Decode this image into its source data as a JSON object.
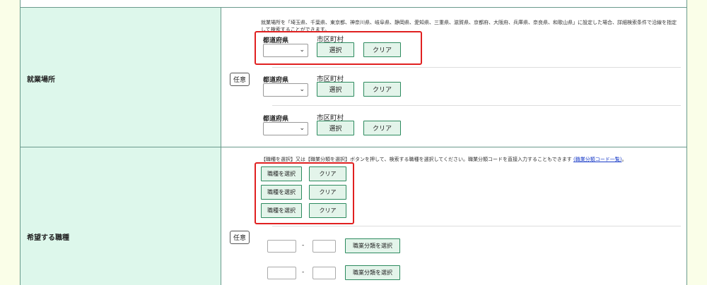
{
  "work_location": {
    "label": "就業場所",
    "optional_badge": "任意",
    "note": "就業場所を「埼玉県、千葉県、東京都、神奈川県、岐阜県、静岡県、愛知県、三重県、滋賀県、京都府、大阪府、兵庫県、奈良県、和歌山県」に設定した場合、詳細検索条件で沿線を指定して検索することができます。",
    "rows": [
      {
        "pref_label": "都道府県",
        "city_label": "市区町村",
        "select_button": "選択",
        "clear_button": "クリア"
      },
      {
        "pref_label": "都道府県",
        "city_label": "市区町村",
        "select_button": "選択",
        "clear_button": "クリア"
      },
      {
        "pref_label": "都道府県",
        "city_label": "市区町村",
        "select_button": "選択",
        "clear_button": "クリア"
      }
    ]
  },
  "desired_job": {
    "label": "希望する職種",
    "optional_badge": "任意",
    "note_text": "【職種を選択】又は【職業分類を選択】ボタンを押して、検索する職種を選択してください。職業分類コードを直接入力することもできます",
    "note_link": "(職業分類コード一覧)",
    "note_end": "。",
    "job_rows": [
      {
        "select_button": "職種を選択",
        "clear_button": "クリア"
      },
      {
        "select_button": "職種を選択",
        "clear_button": "クリア"
      },
      {
        "select_button": "職種を選択",
        "clear_button": "クリア"
      }
    ],
    "code_rows": [
      {
        "dash": "-",
        "button": "職業分類を選択"
      },
      {
        "dash": "-",
        "button": "職業分類を選択"
      }
    ]
  },
  "colors": {
    "label_bg": "#ddf7eb",
    "button_bg": "#e3f4ea",
    "button_border": "#2c8a5e",
    "highlight": "#e02020",
    "page_bg": "#fafee8"
  }
}
